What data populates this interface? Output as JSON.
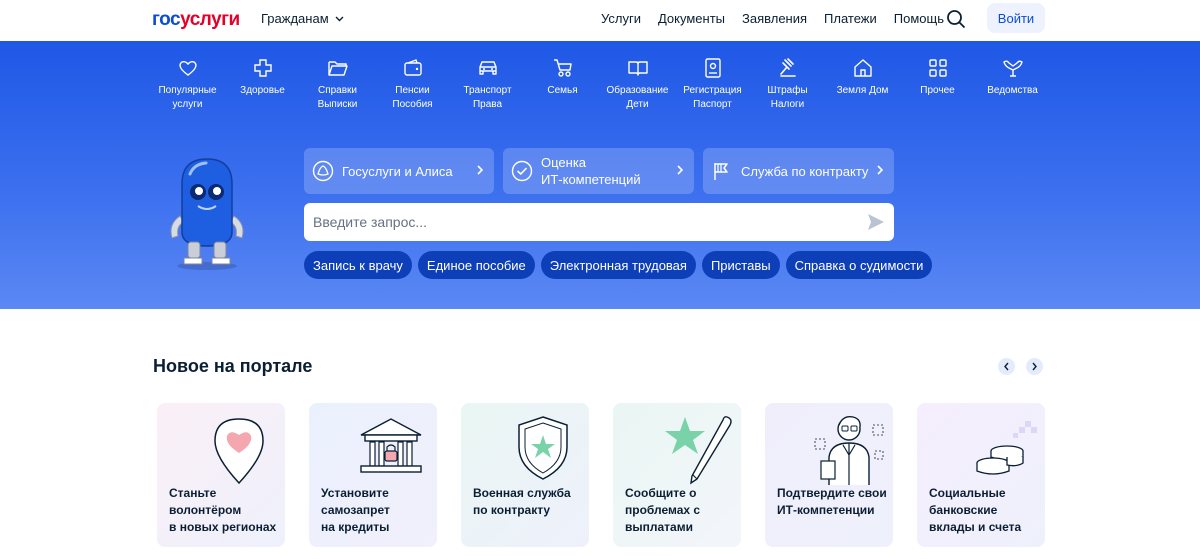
{
  "header": {
    "logo_part1": "гос",
    "logo_part2": "услуги",
    "audience": "Гражданам",
    "nav": [
      "Услуги",
      "Документы",
      "Заявления",
      "Платежи",
      "Помощь"
    ],
    "login": "Войти"
  },
  "categories": [
    {
      "line1": "Популярные",
      "line2": "услуги",
      "icon": "heart-icon"
    },
    {
      "line1": "Здоровье",
      "line2": "",
      "icon": "cross-icon"
    },
    {
      "line1": "Справки",
      "line2": "Выписки",
      "icon": "folder-icon"
    },
    {
      "line1": "Пенсии",
      "line2": "Пособия",
      "icon": "wallet-icon"
    },
    {
      "line1": "Транспорт",
      "line2": "Права",
      "icon": "car-icon"
    },
    {
      "line1": "Семья",
      "line2": "",
      "icon": "stroller-icon"
    },
    {
      "line1": "Образование",
      "line2": "Дети",
      "icon": "book-icon"
    },
    {
      "line1": "Регистрация",
      "line2": "Паспорт",
      "icon": "passport-icon"
    },
    {
      "line1": "Штрафы",
      "line2": "Налоги",
      "icon": "gavel-icon"
    },
    {
      "line1": "Земля Дом",
      "line2": "",
      "icon": "house-icon"
    },
    {
      "line1": "Прочее",
      "line2": "",
      "icon": "grid-icon"
    },
    {
      "line1": "Ведомства",
      "line2": "",
      "icon": "emblem-icon"
    }
  ],
  "quick_links": [
    {
      "label": "Госуслуги и Алиса",
      "icon": "alice-icon"
    },
    {
      "line1": "Оценка",
      "line2": "ИТ-компетенций",
      "icon": "check-circle-icon"
    },
    {
      "label": "Служба по контракту",
      "icon": "flag-icon"
    }
  ],
  "search": {
    "placeholder": "Введите запрос..."
  },
  "chips": [
    "Запись к врачу",
    "Единое пособие",
    "Электронная трудовая",
    "Приставы",
    "Справка о судимости"
  ],
  "news": {
    "title": "Новое на портале",
    "cards": [
      {
        "lines": [
          "Станьте",
          "волонтёром",
          "в новых регионах"
        ],
        "icon": "heart-pin-icon"
      },
      {
        "lines": [
          "Установите",
          "самозапрет",
          "на кредиты"
        ],
        "icon": "bank-lock-icon"
      },
      {
        "lines": [
          "Военная служба",
          "по контракту"
        ],
        "icon": "shield-star-icon"
      },
      {
        "lines": [
          "Сообщите о",
          "проблемах с",
          "выплатами"
        ],
        "icon": "star-pen-icon"
      },
      {
        "lines": [
          "Подтвердите свои",
          "ИТ-компетенции"
        ],
        "icon": "specialist-icon"
      },
      {
        "lines": [
          "Социальные",
          "банковские",
          "вклады и счета"
        ],
        "icon": "coins-icon"
      }
    ]
  },
  "colors": {
    "brand_blue": "#0d4cd3",
    "brand_red": "#e4002b",
    "hero": "#2e64ea"
  }
}
